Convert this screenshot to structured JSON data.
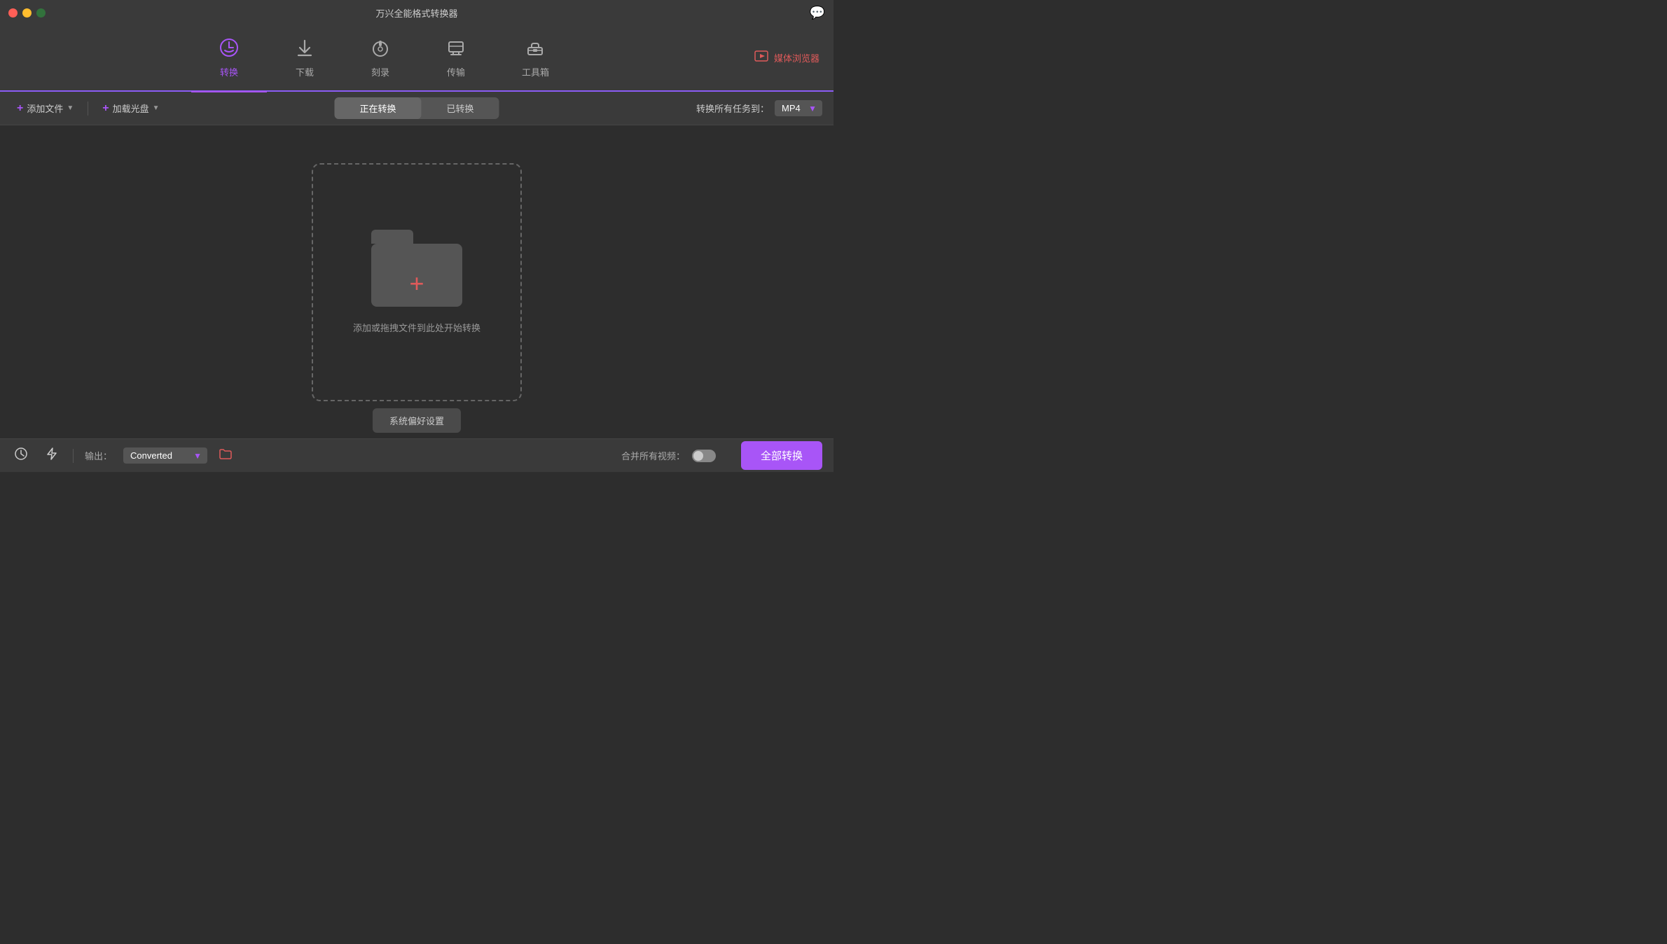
{
  "titlebar": {
    "title": "万兴全能格式转换器",
    "chat_icon": "💬"
  },
  "navbar": {
    "items": [
      {
        "id": "convert",
        "label": "转换",
        "icon": "🔄",
        "active": true
      },
      {
        "id": "download",
        "label": "下载",
        "icon": "⬇️",
        "active": false
      },
      {
        "id": "burn",
        "label": "刻录",
        "icon": "⏺",
        "active": false
      },
      {
        "id": "transfer",
        "label": "传输",
        "icon": "📤",
        "active": false
      },
      {
        "id": "toolbox",
        "label": "工具箱",
        "icon": "🧰",
        "active": false
      }
    ],
    "media_browser_label": "媒体浏览器"
  },
  "toolbar": {
    "add_file_label": "添加文件",
    "add_disc_label": "加载光盘",
    "tabs": [
      {
        "id": "converting",
        "label": "正在转换",
        "active": true
      },
      {
        "id": "converted",
        "label": "已转换",
        "active": false
      }
    ],
    "format_label": "转换所有任务到：",
    "format_value": "MP4"
  },
  "drop_zone": {
    "hint_text": "添加或拖拽文件到此处开始转换"
  },
  "bottom_bar": {
    "output_label": "输出：",
    "output_value": "Converted",
    "merge_label": "合并所有视频：",
    "convert_all_label": "全部转换",
    "sys_pref_label": "系统偏好设置"
  }
}
